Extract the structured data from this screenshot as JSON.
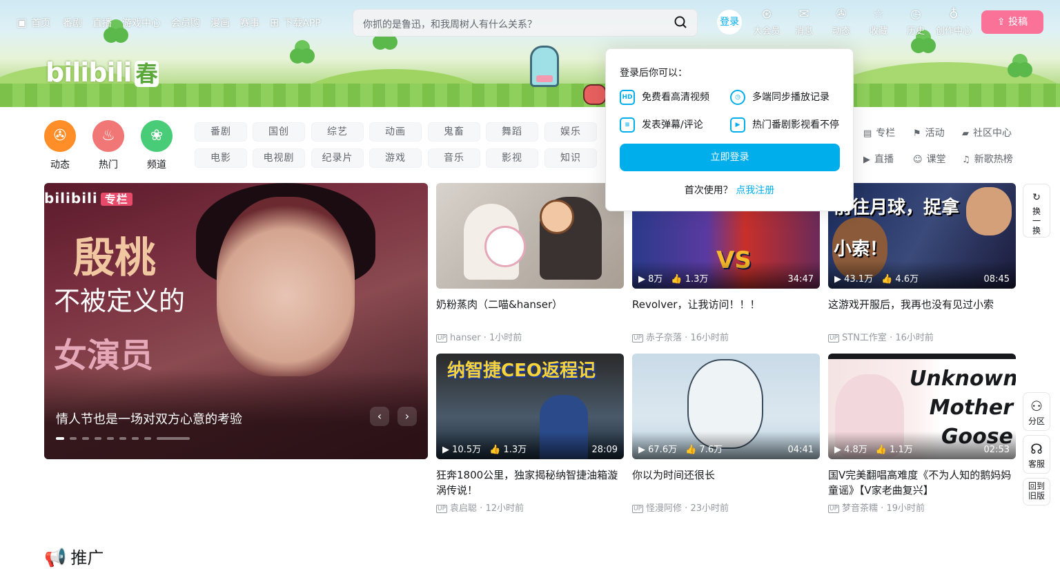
{
  "nav": {
    "left": [
      {
        "label": "首页",
        "icon": "tv-icon"
      },
      {
        "label": "番剧"
      },
      {
        "label": "直播"
      },
      {
        "label": "游戏中心"
      },
      {
        "label": "会员购"
      },
      {
        "label": "漫画"
      },
      {
        "label": "赛事"
      },
      {
        "label": "下载APP",
        "icon": "app-grid-icon"
      }
    ],
    "search_placeholder": "你抓的是鲁迅，和我周树人有什么关系？",
    "login": "登录",
    "right": [
      {
        "label": "大会员",
        "icon": "vip-icon"
      },
      {
        "label": "消息",
        "icon": "mail-icon"
      },
      {
        "label": "动态",
        "icon": "wind-icon"
      },
      {
        "label": "收藏",
        "icon": "star-icon"
      },
      {
        "label": "历史",
        "icon": "clock-icon"
      },
      {
        "label": "创作中心",
        "icon": "bulb-icon"
      }
    ],
    "upload": "投稿"
  },
  "banner": {
    "logo": "bilibili",
    "logo_suffix": "春"
  },
  "channels": [
    {
      "label": "动态",
      "color": "#ff8e29"
    },
    {
      "label": "热门",
      "color": "#f07775"
    },
    {
      "label": "频道",
      "color": "#48cc78"
    }
  ],
  "tags_row1": [
    "番剧",
    "国创",
    "综艺",
    "动画",
    "鬼畜",
    "舞蹈",
    "娱乐"
  ],
  "tags_row2": [
    "电影",
    "电视剧",
    "纪录片",
    "游戏",
    "音乐",
    "影视",
    "知识"
  ],
  "side_links": [
    {
      "label": "专栏"
    },
    {
      "label": "活动"
    },
    {
      "label": "社区中心"
    },
    {
      "label": "直播"
    },
    {
      "label": "课堂"
    },
    {
      "label": "新歌热榜"
    }
  ],
  "carousel": {
    "brand": "bilibili",
    "brand_tag": "专栏",
    "art_line1": "殷桃",
    "art_line2": "不被定义的",
    "art_line3": "女演员",
    "caption": "情人节也是一场对双方心意的考验"
  },
  "videos": [
    {
      "title": "奶粉蒸肉（二喵&hanser）",
      "author": "hanser",
      "time": "1小时前",
      "plays": "",
      "likes": "",
      "duration": ""
    },
    {
      "title": "Revolver，让我访问！！！",
      "author": "赤子奈落",
      "time": "16小时前",
      "plays": "8万",
      "likes": "1.3万",
      "duration": "34:47",
      "thumb_text": "VS"
    },
    {
      "title": "这游戏开服后，我再也没有见过小索",
      "author": "STN工作室",
      "time": "16小时前",
      "plays": "43.1万",
      "likes": "4.6万",
      "duration": "08:45",
      "thumb_text": "前往月球，捉拿小索！"
    },
    {
      "title": "狂奔1800公里，独家揭秘纳智捷油箱漩涡传说！",
      "author": "袁启聪",
      "time": "12小时前",
      "plays": "10.5万",
      "likes": "1.3万",
      "duration": "28:09",
      "thumb_text": "纳智捷CEO返程记"
    },
    {
      "title": "你以为时间还很长",
      "author": "怪漫阿修",
      "time": "23小时前",
      "plays": "67.6万",
      "likes": "7.6万",
      "duration": "04:41"
    },
    {
      "title": "国V完美翻唱高难度《不为人知的鹅妈妈童谣》【V家老曲复兴】",
      "author": "梦音茶糯",
      "time": "19小时前",
      "plays": "4.8万",
      "likes": "1.1万",
      "duration": "02:53",
      "thumb_text": "Unknown Mother Goose"
    }
  ],
  "popup": {
    "heading": "登录后你可以：",
    "features": [
      "免费看高清视频",
      "多端同步播放记录",
      "发表弹幕/评论",
      "热门番剧影视看不停"
    ],
    "login_button": "立即登录",
    "first_use": "首次使用？",
    "register": "点我注册"
  },
  "float": {
    "refresh": "换一换",
    "zones": "分区",
    "service": "客服",
    "old": "回到旧版"
  },
  "promo_title": "推广",
  "colors": {
    "accent": "#00aeec",
    "pink": "#fb7299"
  }
}
